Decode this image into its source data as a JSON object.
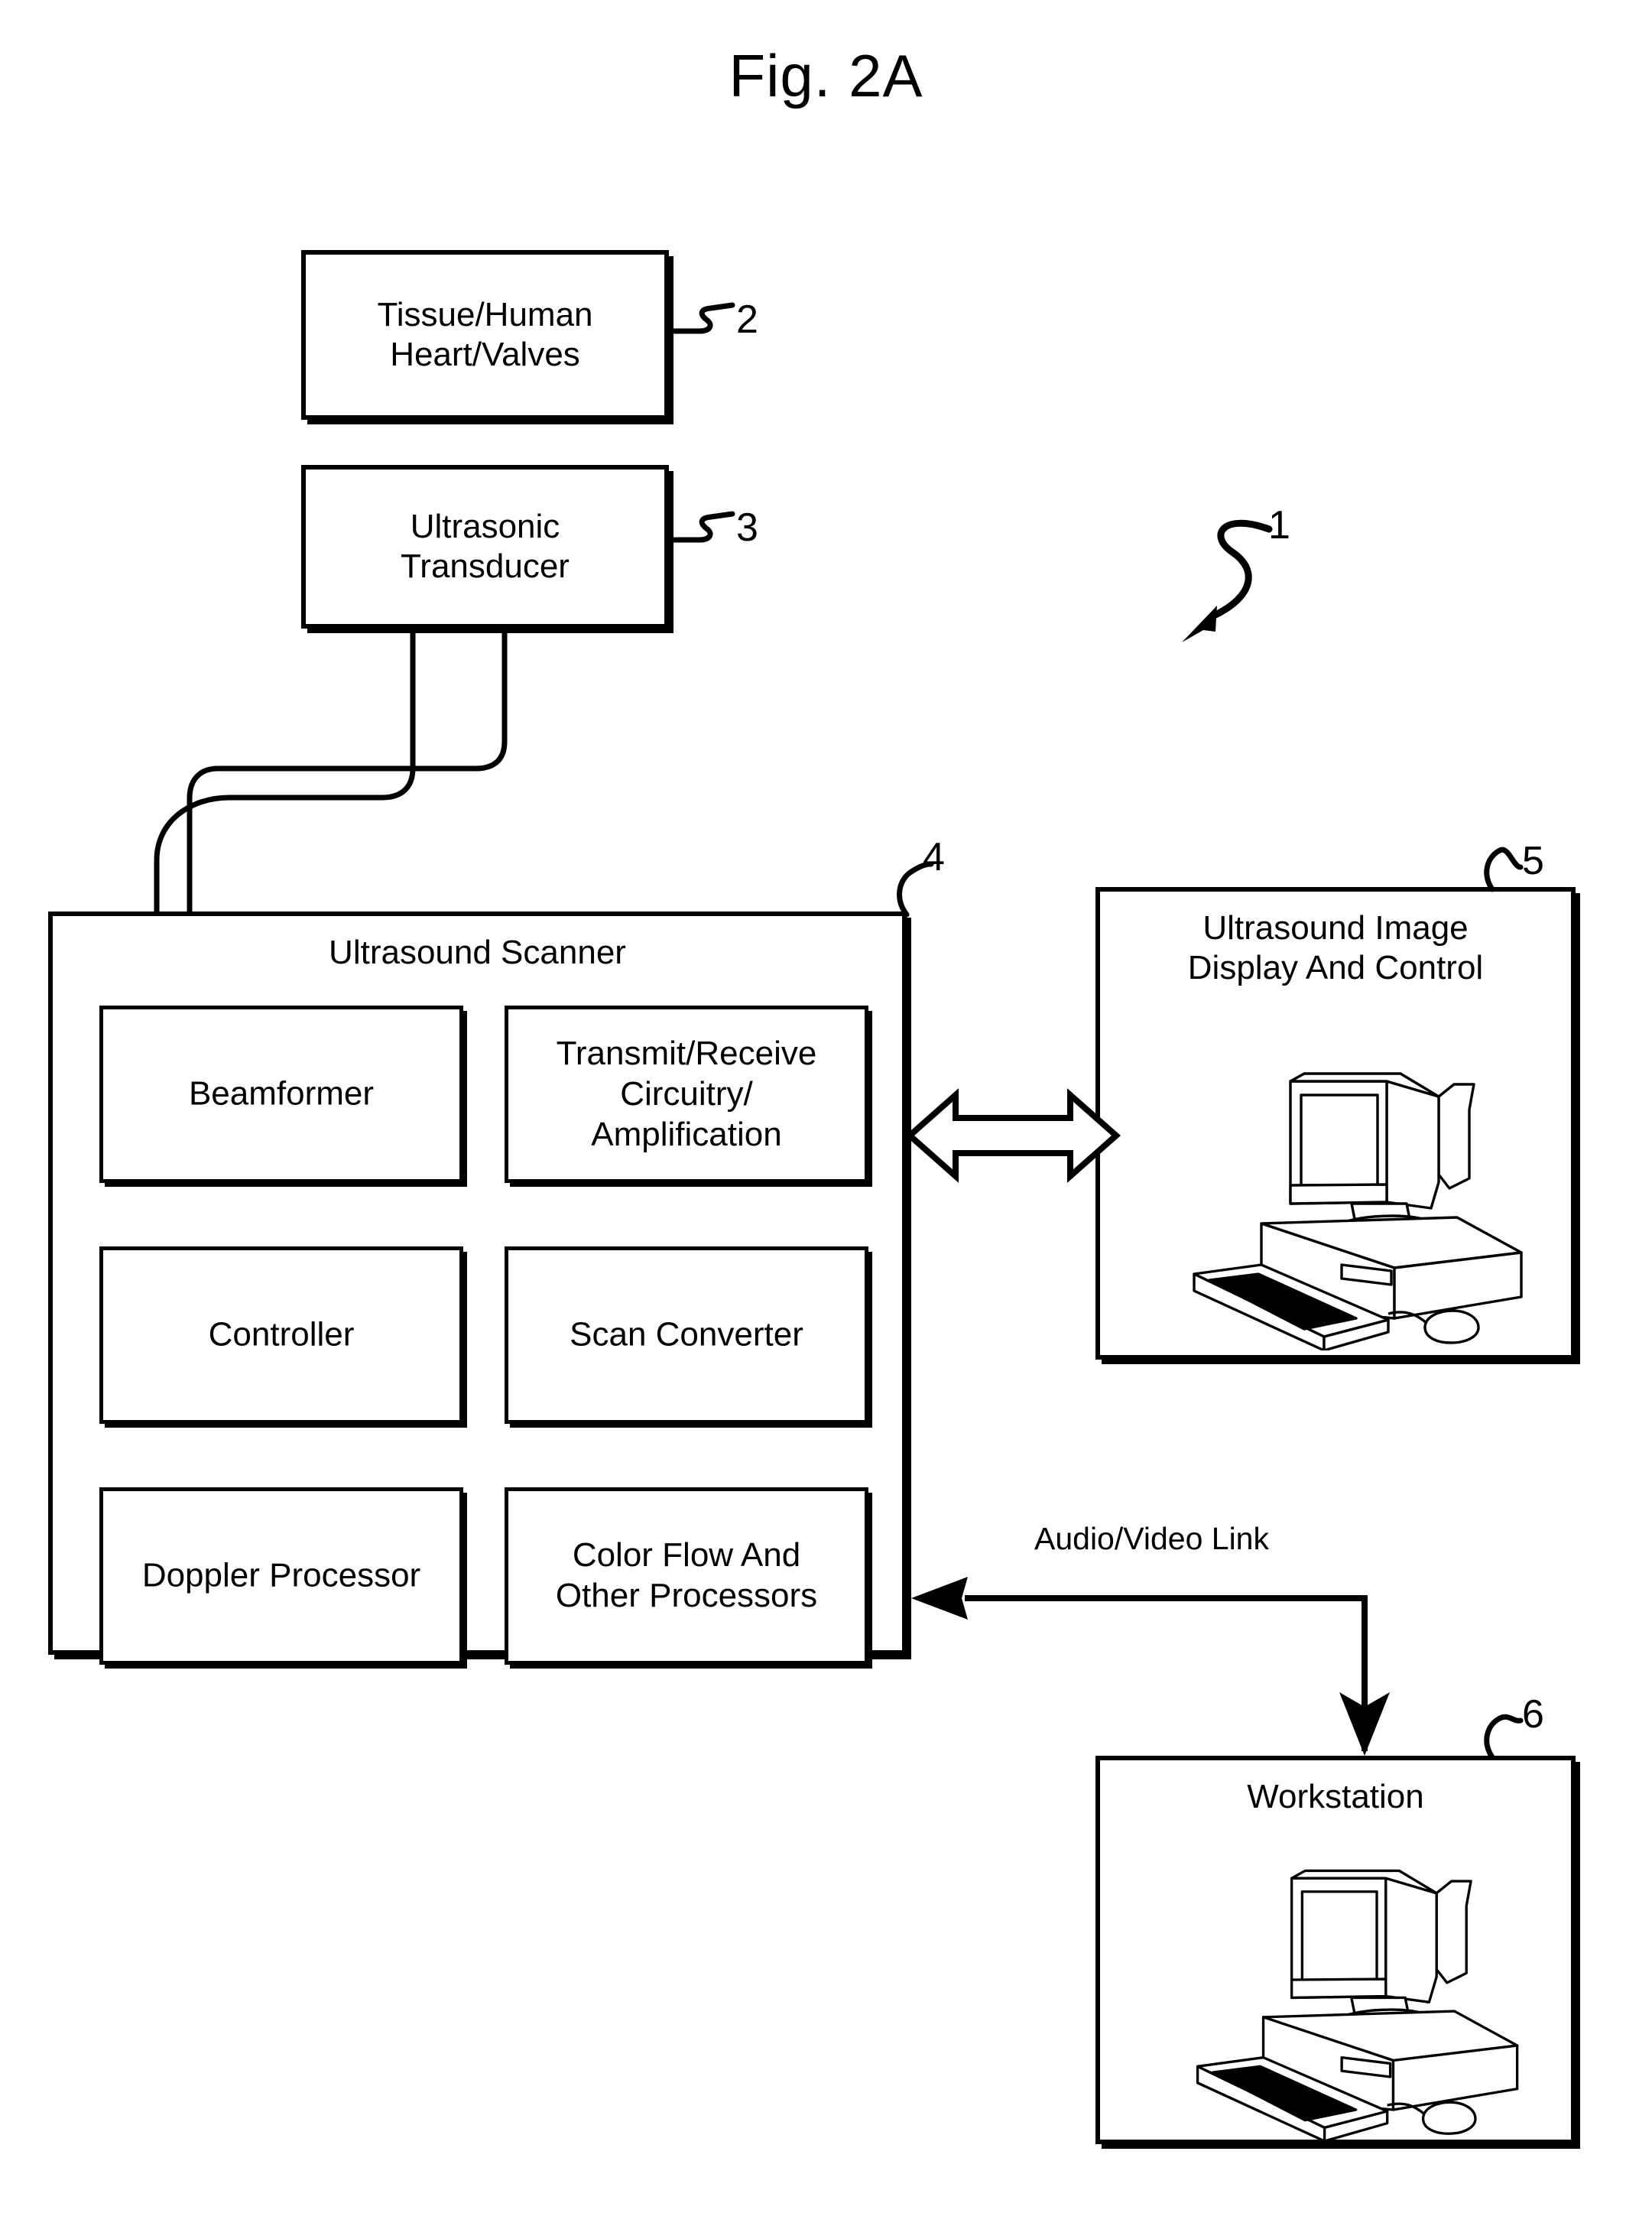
{
  "figure": {
    "title": "Fig. 2A",
    "overall_ref": "1"
  },
  "blocks": [
    {
      "id": "tissue",
      "label": "Tissue/Human\nHeart/Valves",
      "ref": "2"
    },
    {
      "id": "transducer",
      "label": "Ultrasonic\nTransducer",
      "ref": "3"
    },
    {
      "id": "scanner",
      "label": "Ultrasound Scanner",
      "ref": "4"
    },
    {
      "id": "display",
      "label": "Ultrasound Image\nDisplay And Control",
      "ref": "5"
    },
    {
      "id": "workstation",
      "label": "Workstation",
      "ref": "6"
    }
  ],
  "scanner_modules": [
    {
      "id": "beamformer",
      "label": "Beamformer"
    },
    {
      "id": "transmit-receive",
      "label": "Transmit/Receive\nCircuitry/\nAmplification"
    },
    {
      "id": "controller",
      "label": "Controller"
    },
    {
      "id": "scan-converter",
      "label": "Scan Converter"
    },
    {
      "id": "doppler-processor",
      "label": "Doppler Processor"
    },
    {
      "id": "color-flow",
      "label": "Color Flow And\nOther Processors"
    }
  ],
  "connections": [
    {
      "id": "av-link",
      "label": "Audio/Video Link"
    }
  ],
  "colors": {
    "ink": "#000000",
    "paper": "#ffffff"
  }
}
